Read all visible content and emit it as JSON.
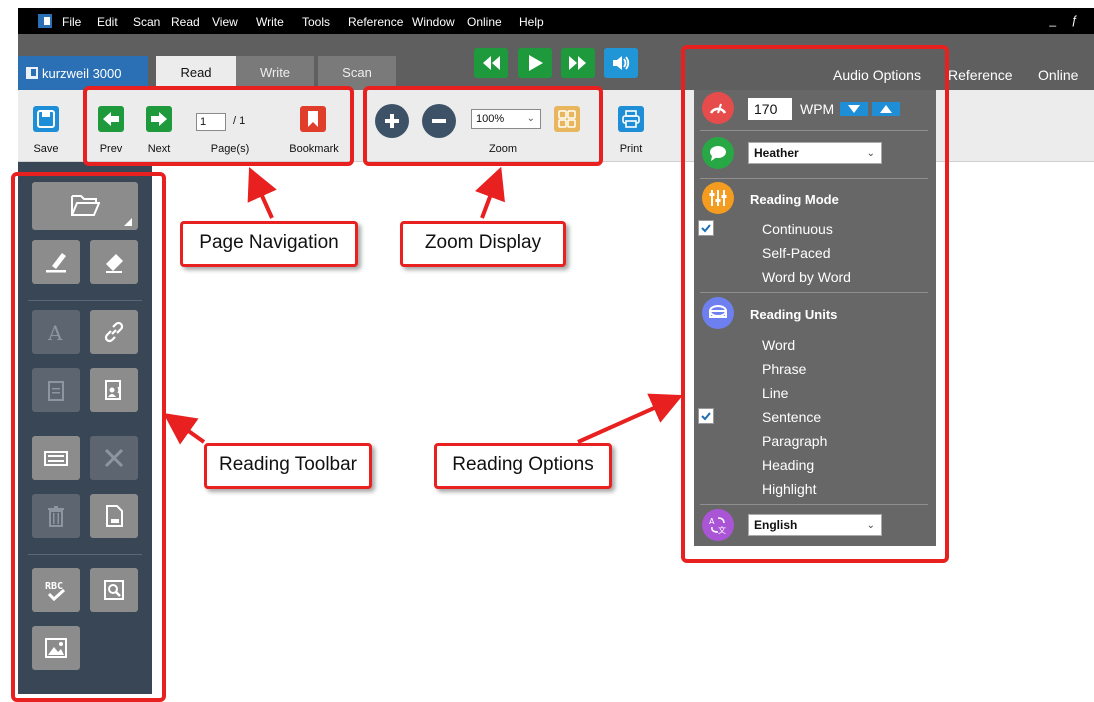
{
  "menubar": {
    "items": [
      "File",
      "Edit",
      "Scan",
      "Read",
      "View",
      "Write",
      "Tools",
      "Reference",
      "Window",
      "Online",
      "Help"
    ],
    "window_controls": "_ ƒ"
  },
  "header": {
    "brand": "kurzweil 3000",
    "tabs": [
      "Read",
      "Write",
      "Scan"
    ],
    "active_tab": "Read",
    "right_links": [
      "Reference",
      "Online"
    ]
  },
  "ribbon": {
    "save_label": "Save",
    "prev_label": "Prev",
    "next_label": "Next",
    "page_value": "1",
    "page_total": "/ 1",
    "pages_label": "Page(s)",
    "bookmark_label": "Bookmark",
    "zoom_value": "100%",
    "zoom_label": "Zoom",
    "print_label": "Print"
  },
  "audio_options": {
    "tab_label": "Audio Options",
    "wpm_value": "170",
    "wpm_label": "WPM",
    "voice": "Heather",
    "reading_mode": {
      "heading": "Reading Mode",
      "options": [
        "Continuous",
        "Self-Paced",
        "Word by Word"
      ],
      "checked": "Continuous"
    },
    "reading_units": {
      "heading": "Reading Units",
      "options": [
        "Word",
        "Phrase",
        "Line",
        "Sentence",
        "Paragraph",
        "Heading",
        "Highlight"
      ],
      "checked": "Sentence"
    },
    "language": "English"
  },
  "annotations": {
    "page_navigation": "Page Navigation",
    "zoom_display": "Zoom Display",
    "reading_toolbar": "Reading Toolbar",
    "reading_options": "Reading Options"
  },
  "colors": {
    "annotation_red": "#e8201f",
    "menubar": "#000000",
    "header": "#5f5f5f",
    "brand_blue": "#2b6fb4",
    "ribbon": "#ececec",
    "left_panel": "#394656",
    "audio_panel": "#676767",
    "playback_green": "#1e9a3c",
    "speaker_blue": "#2196d6"
  },
  "icons": {
    "menubar": [
      "app-logo-icon"
    ],
    "playback": [
      "rewind-icon",
      "play-icon",
      "fast-forward-icon",
      "speaker-icon"
    ],
    "ribbon": [
      "save-icon",
      "prev-arrow-icon",
      "next-arrow-icon",
      "bookmark-icon",
      "zoom-in-icon",
      "zoom-out-icon",
      "thumbnails-icon",
      "print-icon"
    ],
    "left_toolbar": [
      "open-folder-icon",
      "highlighter-icon",
      "eraser-icon",
      "text-note-icon",
      "link-icon",
      "extract-icon",
      "read-aloud-note-icon",
      "keyboard-icon",
      "close-icon",
      "trash-icon",
      "document-icon",
      "spell-check-icon",
      "search-document-icon",
      "image-icon"
    ],
    "audio_options": [
      "speedometer-icon",
      "voice-bubble-icon",
      "reading-mode-icon",
      "reading-units-icon",
      "language-icon"
    ]
  }
}
